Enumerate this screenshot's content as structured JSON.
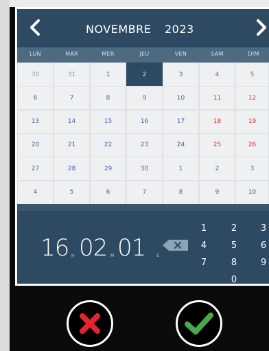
{
  "calendar": {
    "month": "NOVEMBRE",
    "year": "2023",
    "weekdays": [
      "LUN",
      "MAR",
      "MER",
      "JEU",
      "VEN",
      "SAM",
      "DIM"
    ],
    "weeks": [
      [
        "30",
        "31",
        "1",
        "2",
        "3",
        "4",
        "5"
      ],
      [
        "6",
        "7",
        "8",
        "9",
        "10",
        "11",
        "12"
      ],
      [
        "13",
        "14",
        "15",
        "16",
        "17",
        "18",
        "19"
      ],
      [
        "20",
        "21",
        "22",
        "23",
        "24",
        "25",
        "26"
      ],
      [
        "27",
        "28",
        "29",
        "30",
        "1",
        "2",
        "3"
      ],
      [
        "4",
        "5",
        "6",
        "7",
        "8",
        "9",
        "10"
      ]
    ],
    "selected_day": "2"
  },
  "time": {
    "hours": "16",
    "minutes": "02",
    "seconds": "01",
    "hours_unit": "H",
    "minutes_unit": "M",
    "seconds_unit": "S"
  },
  "keypad": [
    "1",
    "2",
    "3",
    "4",
    "5",
    "6",
    "7",
    "8",
    "9",
    "0"
  ],
  "icons": {
    "prev": "chevron-left-icon",
    "next": "chevron-right-icon",
    "backspace": "backspace-icon",
    "cancel": "cross-icon",
    "confirm": "check-icon"
  },
  "colors": {
    "header": "#2e4a63",
    "weekday_bar": "#4d6a80",
    "day_text": "#4a64a8",
    "weekend_text": "#e0332f",
    "selected": "#2e4a63",
    "cancel": "#e8242b",
    "confirm": "#48a94a"
  }
}
